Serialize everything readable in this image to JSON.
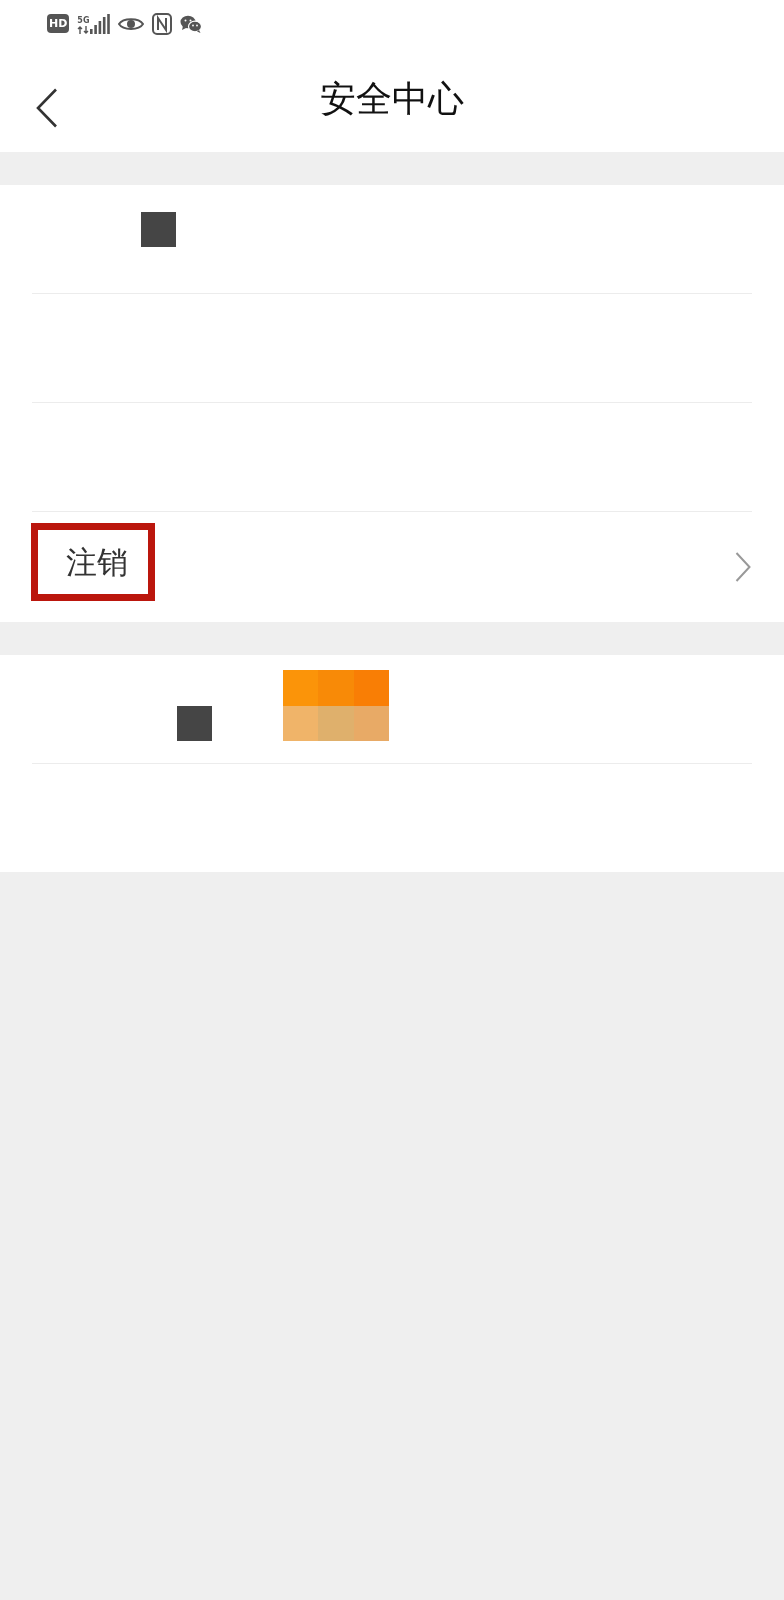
{
  "status_bar": {
    "hd_badge": "HD",
    "network": "5G"
  },
  "header": {
    "title": "安全中心"
  },
  "sections": [
    {
      "rows": [
        {
          "kind": "masked"
        },
        {
          "kind": "blank"
        },
        {
          "kind": "blank"
        },
        {
          "kind": "link",
          "label": "注销",
          "highlighted": true
        }
      ]
    },
    {
      "rows": [
        {
          "kind": "mosaic"
        },
        {
          "kind": "blank"
        }
      ]
    }
  ]
}
